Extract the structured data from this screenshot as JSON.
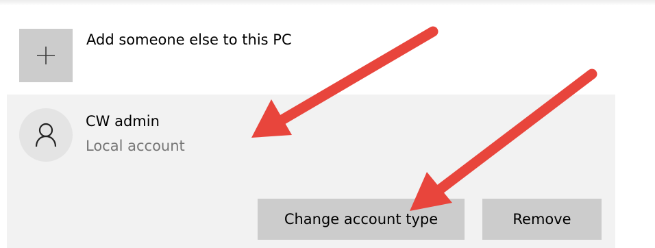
{
  "add_user": {
    "label": "Add someone else to this PC",
    "icon": "plus-icon"
  },
  "account": {
    "name": "CW admin",
    "type": "Local account",
    "icon": "person-icon"
  },
  "actions": {
    "change_type_label": "Change account type",
    "remove_label": "Remove"
  },
  "colors": {
    "tile_bg": "#cccccc",
    "card_bg": "#f2f2f2",
    "button_bg": "#cccccc",
    "secondary_text": "#767676",
    "arrow": "#e8453c"
  }
}
